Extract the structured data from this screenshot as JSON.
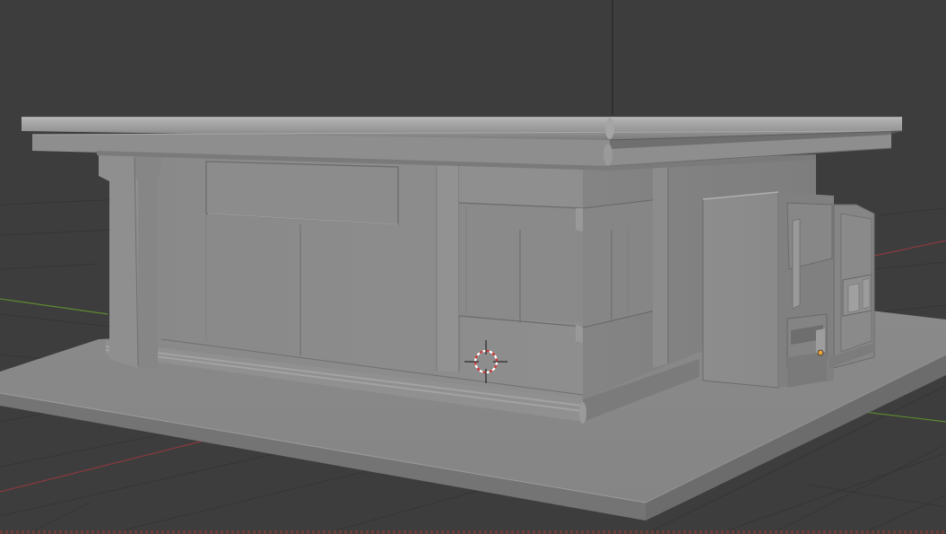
{
  "viewport": {
    "mode": "3d-viewport",
    "shading": "solid",
    "background_color": "#3d3d3d",
    "grid_color": "#353535",
    "x_axis_color": "#8a3a3f",
    "y_axis_color": "#5c8a30",
    "z_axis_color": "#2a2a2a"
  },
  "scene": {
    "objects": [
      {
        "name": "ground-slab",
        "icon": "plane-mesh"
      },
      {
        "name": "building",
        "icon": "cube-mesh"
      },
      {
        "name": "roof",
        "icon": "cube-mesh"
      },
      {
        "name": "sign-panel",
        "icon": "cube-mesh"
      },
      {
        "name": "vending-machine-large",
        "icon": "cube-mesh"
      },
      {
        "name": "vending-machine-small",
        "icon": "cube-mesh"
      }
    ],
    "cursor": {
      "icon": "3d-cursor-icon"
    },
    "selected_origin": {
      "icon": "origin-dot-icon",
      "color": "#e8a33a"
    }
  }
}
